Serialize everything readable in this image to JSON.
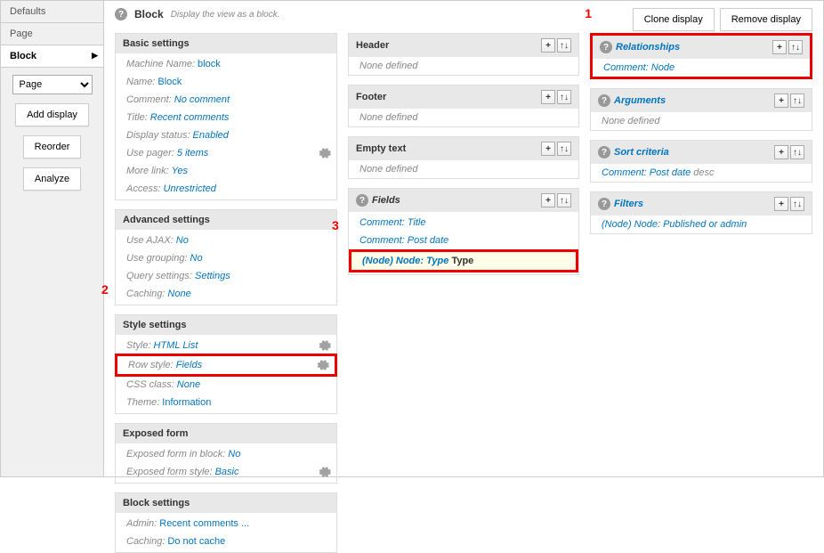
{
  "tabs": [
    "Defaults",
    "Page",
    "Block"
  ],
  "controls": {
    "select_value": "Page",
    "add_display": "Add display",
    "reorder": "Reorder",
    "analyze": "Analyze"
  },
  "header": {
    "title": "Block",
    "desc": "Display the view as a block."
  },
  "topright": {
    "clone": "Clone display",
    "remove": "Remove display"
  },
  "basic": {
    "title": "Basic settings",
    "rows": [
      {
        "label": "Machine Name:",
        "value": "block"
      },
      {
        "label": "Name:",
        "value": "Block"
      },
      {
        "label": "Comment:",
        "value": "No comment"
      },
      {
        "label": "Title:",
        "value": "Recent comments"
      },
      {
        "label": "Display status:",
        "value": "Enabled"
      },
      {
        "label": "Use pager:",
        "value": "5 items"
      },
      {
        "label": "More link:",
        "value": "Yes"
      },
      {
        "label": "Access:",
        "value": "Unrestricted"
      }
    ]
  },
  "advanced": {
    "title": "Advanced settings",
    "rows": [
      {
        "label": "Use AJAX:",
        "value": "No"
      },
      {
        "label": "Use grouping:",
        "value": "No"
      },
      {
        "label": "Query settings:",
        "value": "Settings"
      },
      {
        "label": "Caching:",
        "value": "None"
      }
    ]
  },
  "style": {
    "title": "Style settings",
    "rows": [
      {
        "label": "Style:",
        "value": "HTML List"
      },
      {
        "label": "Row style:",
        "value": "Fields"
      },
      {
        "label": "CSS class:",
        "value": "None"
      },
      {
        "label": "Theme:",
        "value": "Information"
      }
    ]
  },
  "exposed": {
    "title": "Exposed form",
    "rows": [
      {
        "label": "Exposed form in block:",
        "value": "No"
      },
      {
        "label": "Exposed form style:",
        "value": "Basic"
      }
    ]
  },
  "block": {
    "title": "Block settings",
    "rows": [
      {
        "label": "Admin:",
        "value": "Recent comments ..."
      },
      {
        "label": "Caching:",
        "value": "Do not cache"
      }
    ]
  },
  "col2": {
    "header": {
      "title": "Header",
      "none": "None defined"
    },
    "footer": {
      "title": "Footer",
      "none": "None defined"
    },
    "empty": {
      "title": "Empty text",
      "none": "None defined"
    },
    "fields": {
      "title": "Fields",
      "items": [
        "Comment: Title",
        "Comment: Post date"
      ],
      "highlight": {
        "link": "(Node) Node: Type",
        "plain": "Type"
      }
    }
  },
  "col3": {
    "relationships": {
      "title": "Relationships",
      "items": [
        "Comment: Node"
      ]
    },
    "arguments": {
      "title": "Arguments",
      "none": "None defined"
    },
    "sort": {
      "title": "Sort criteria",
      "items": [
        {
          "link": "Comment: Post date",
          "suffix": "desc"
        }
      ]
    },
    "filters": {
      "title": "Filters",
      "items": [
        "(Node) Node: Published or admin"
      ]
    }
  },
  "annotations": {
    "a1": "1",
    "a2": "2",
    "a3": "3"
  }
}
